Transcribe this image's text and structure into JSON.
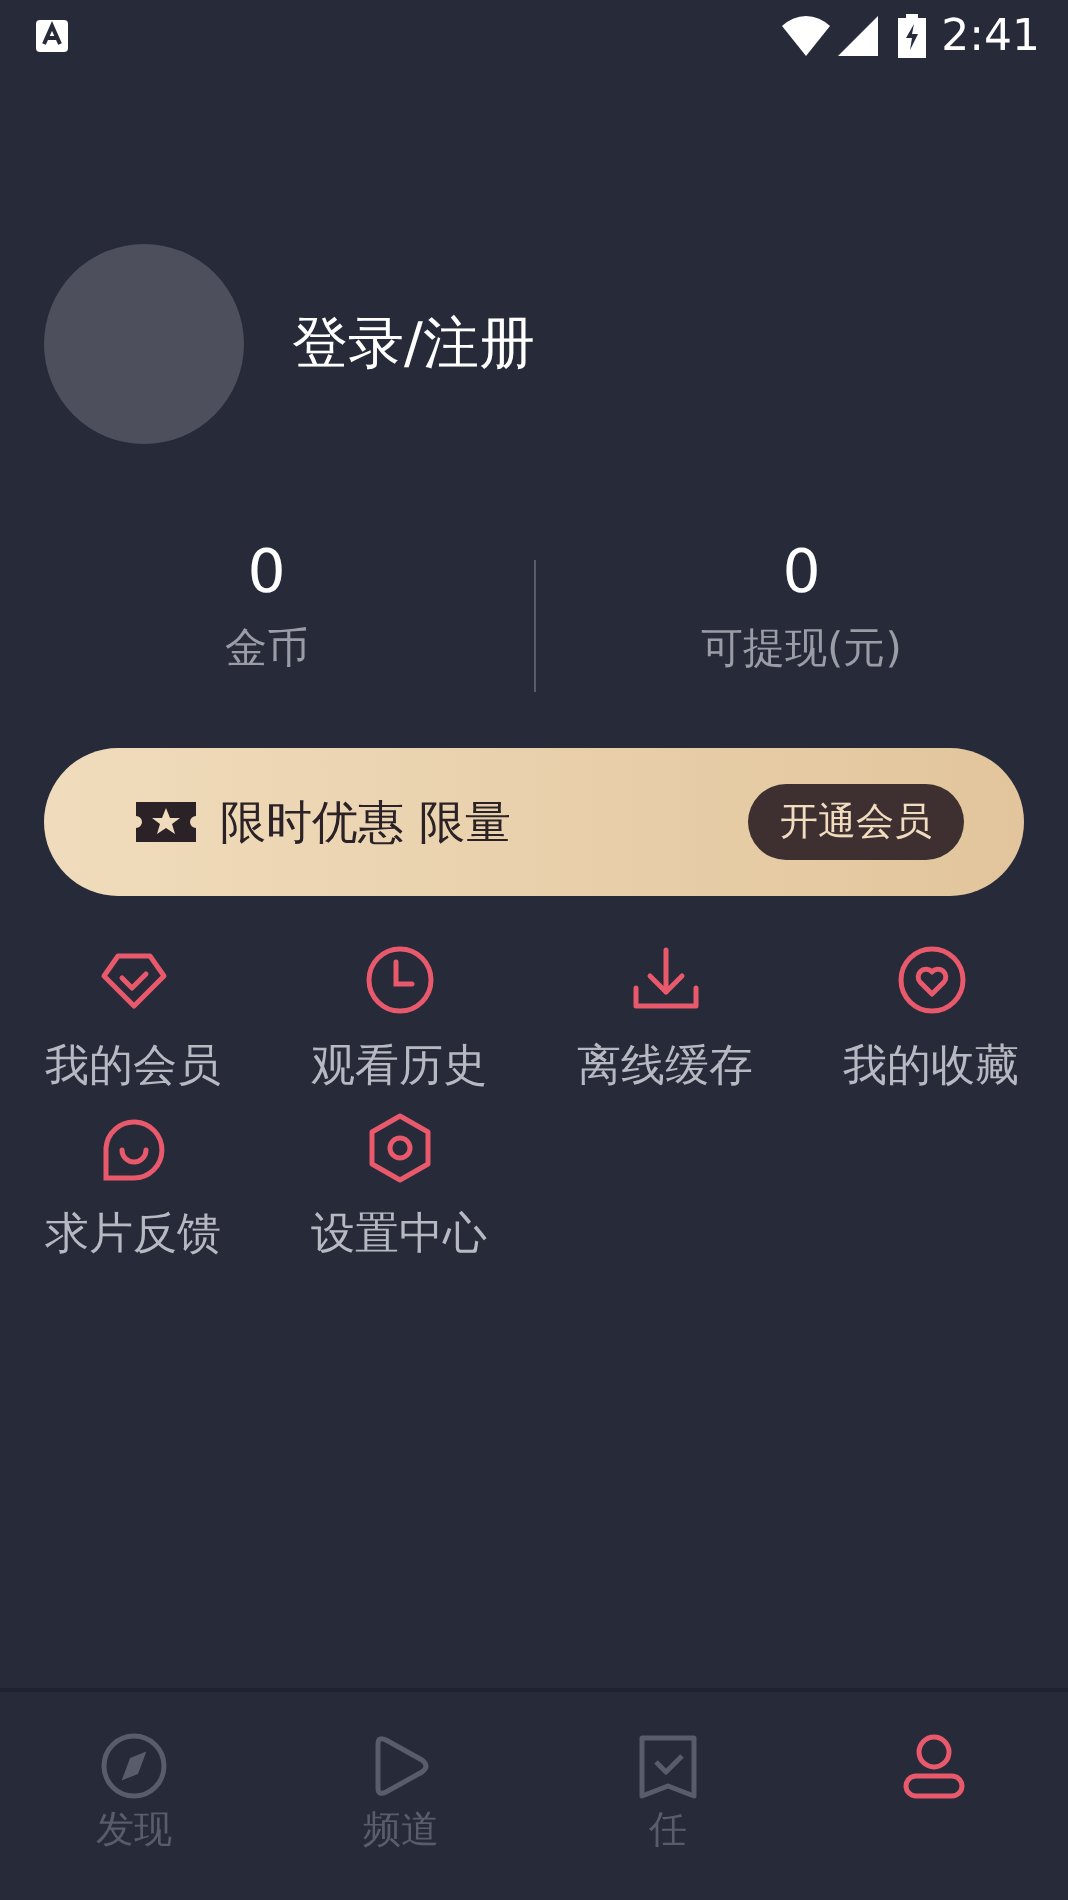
{
  "status_bar": {
    "time": "2:41"
  },
  "profile": {
    "login": "登录/注册"
  },
  "stats": [
    {
      "value": "0",
      "label": "金币"
    },
    {
      "value": "0",
      "label": "可提现(元)"
    }
  ],
  "promo": {
    "text": "限时优惠 限量",
    "button": "开通会员"
  },
  "menu": [
    {
      "label": "我的会员"
    },
    {
      "label": "观看历史"
    },
    {
      "label": "离线缓存"
    },
    {
      "label": "我的收藏"
    },
    {
      "label": "求片反馈"
    },
    {
      "label": "设置中心"
    }
  ],
  "bottom_nav": [
    {
      "label": "发现",
      "selected": false
    },
    {
      "label": "频道",
      "selected": false
    },
    {
      "label": "任",
      "selected": false
    },
    {
      "selected": true
    }
  ]
}
